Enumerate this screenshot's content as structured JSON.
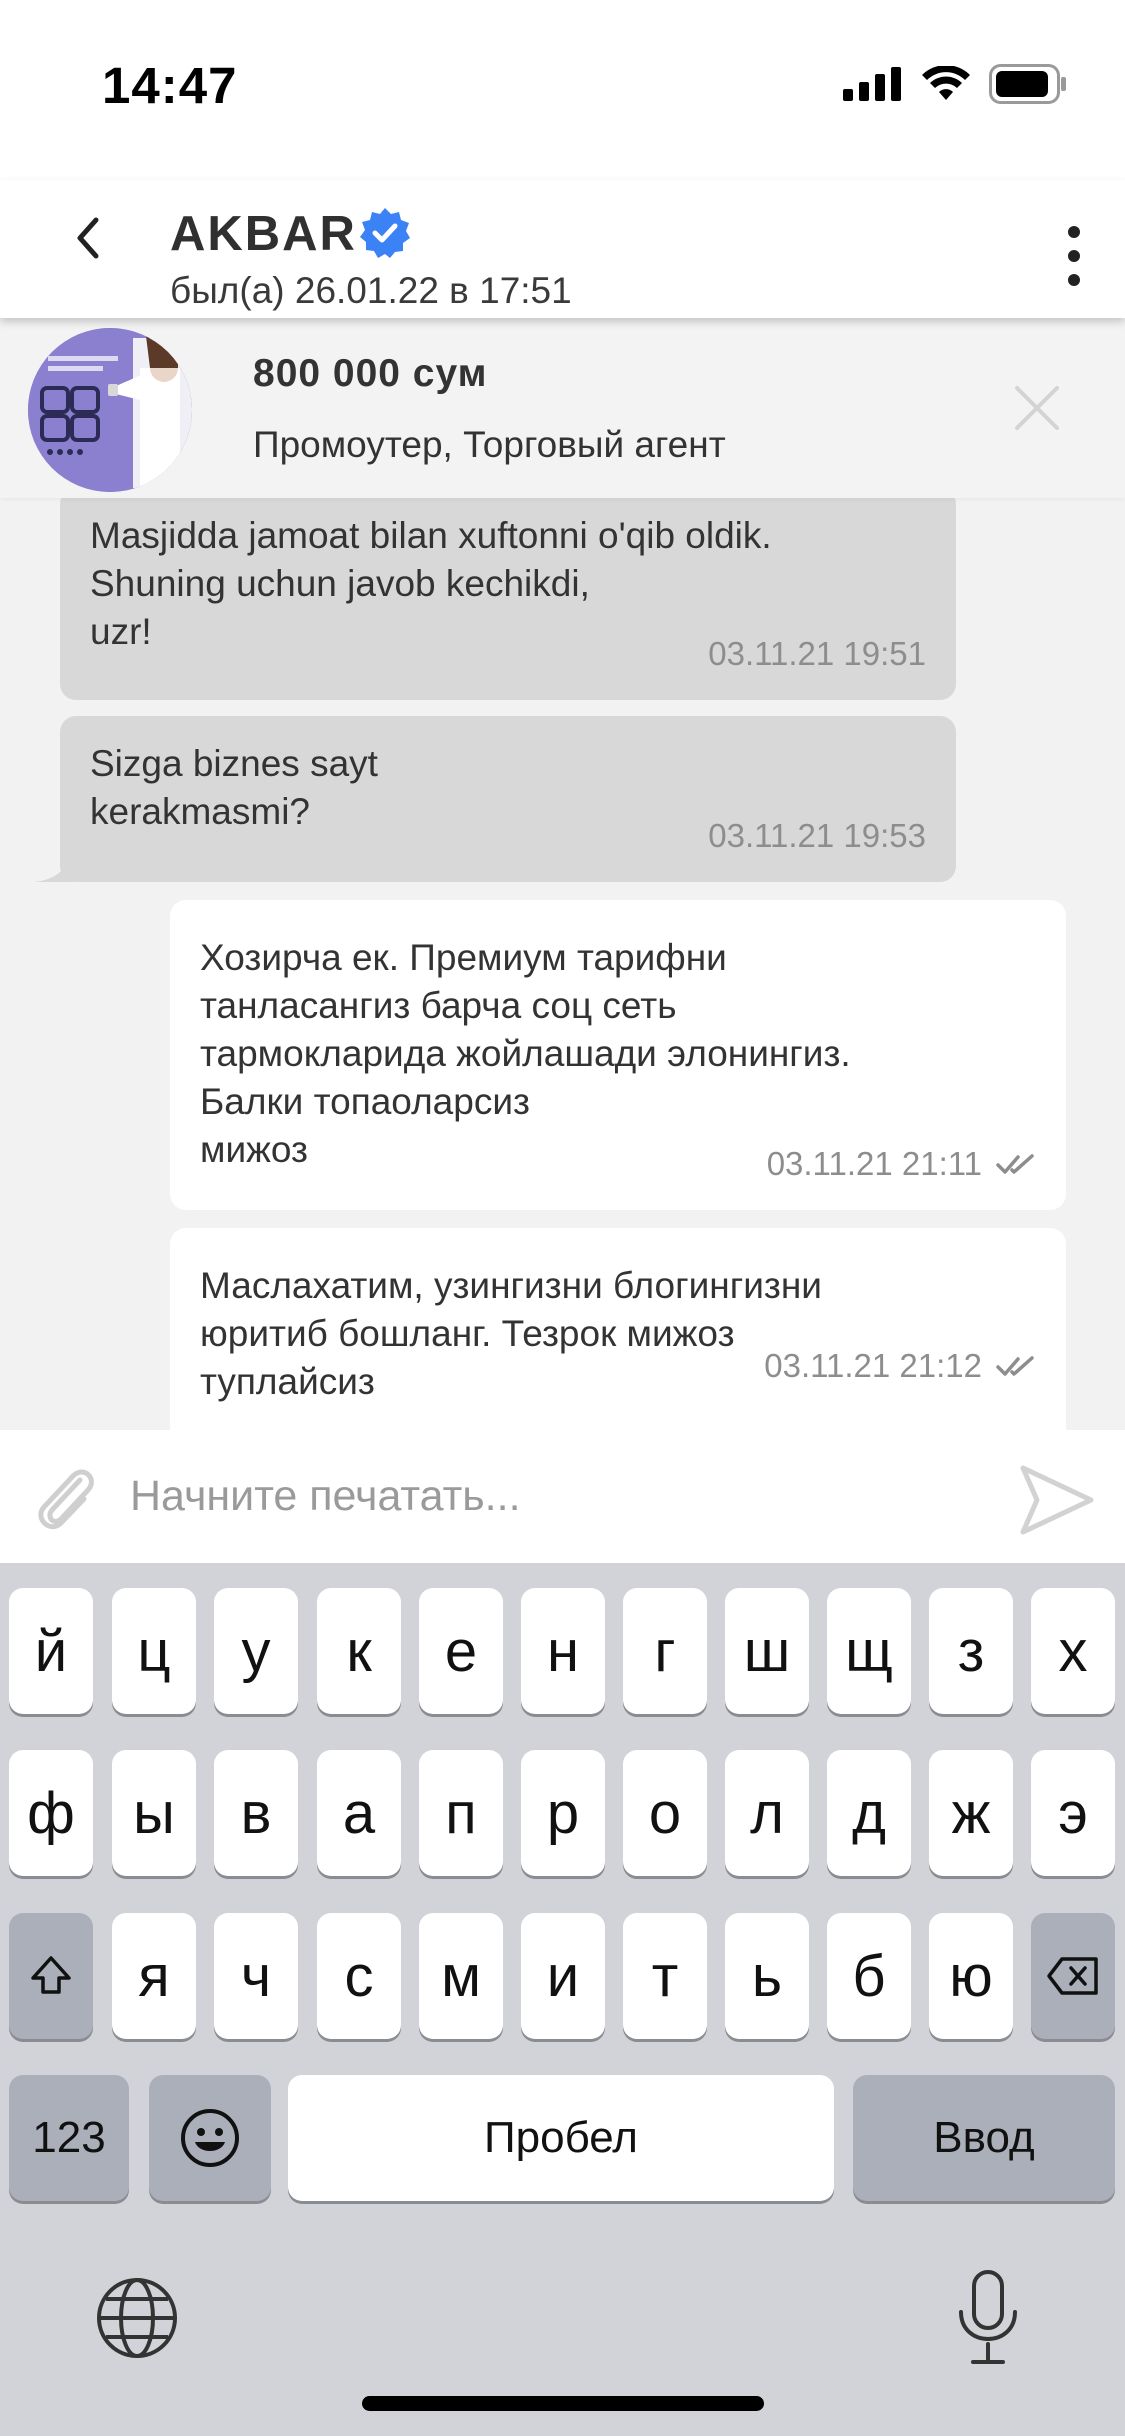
{
  "status_bar": {
    "time": "14:47"
  },
  "header": {
    "contact_name": "AKBAR",
    "last_seen": "был(а) 26.01.22 в 17:51",
    "verified_color": "#3b82f6"
  },
  "job_banner": {
    "price": "800 000 сум",
    "title": "Промоутер, Торговый агент"
  },
  "messages": [
    {
      "direction": "incoming",
      "text": "Masjidda jamoat bilan xuftonni o'qib oldik.\nShuning uchun javob kechikdi,\nuzr!",
      "time": "03.11.21 19:51"
    },
    {
      "direction": "incoming",
      "text": "Sizga biznes sayt\nkerakmasmi?",
      "time": "03.11.21 19:53"
    },
    {
      "direction": "outgoing",
      "text": "Хозирча ек. Премиум тарифни\nтанласангиз барча соц сеть\nтармокларида жойлашади элонингиз.\nБалки топаоларсиз\nмижоз",
      "time": "03.11.21 21:11",
      "read": true
    },
    {
      "direction": "outgoing",
      "text": "Маслахатим, узингизни блогингизни\nюритиб бошланг. Тезрок мижоз\nтуплайсиз",
      "time": "03.11.21 21:12",
      "read": true
    }
  ],
  "composer": {
    "placeholder": "Начните печатать..."
  },
  "keyboard": {
    "row1": [
      "й",
      "ц",
      "у",
      "к",
      "е",
      "н",
      "г",
      "ш",
      "щ",
      "з",
      "х"
    ],
    "row2": [
      "ф",
      "ы",
      "в",
      "а",
      "п",
      "р",
      "о",
      "л",
      "д",
      "ж",
      "э"
    ],
    "row3": [
      "я",
      "ч",
      "с",
      "м",
      "и",
      "т",
      "ь",
      "б",
      "ю"
    ],
    "numbers_label": "123",
    "space_label": "Пробел",
    "return_label": "Ввод"
  }
}
